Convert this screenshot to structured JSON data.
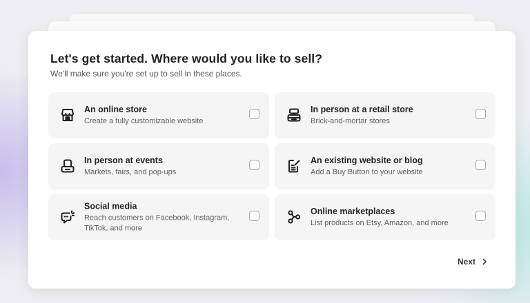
{
  "page": {
    "title": "Let's get started. Where would you like to sell?",
    "subtitle": "We'll make sure you're set up to sell in these places."
  },
  "options": [
    {
      "title": "An online store",
      "description": "Create a fully customizable website",
      "icon": "storefront-icon",
      "checked": false
    },
    {
      "title": "In person at a retail store",
      "description": "Brick-and-mortar stores",
      "icon": "pos-terminal-icon",
      "checked": false
    },
    {
      "title": "In person at events",
      "description": "Markets, fairs, and pop-ups",
      "icon": "card-reader-icon",
      "checked": false
    },
    {
      "title": "An existing website or blog",
      "description": "Add a Buy Button to your website",
      "icon": "edit-document-icon",
      "checked": false
    },
    {
      "title": "Social media",
      "description": "Reach customers on Facebook, Instagram, TikTok, and more",
      "icon": "chat-bubble-icon",
      "checked": false
    },
    {
      "title": "Online marketplaces",
      "description": "List products on Etsy, Amazon, and more",
      "icon": "nodes-icon",
      "checked": false
    }
  ],
  "footer": {
    "next_label": "Next",
    "next_icon": "chevron-right-icon"
  },
  "colors": {
    "card_background": "#ffffff",
    "option_background": "#f5f5f6",
    "text_primary": "#232327",
    "text_secondary": "#616166"
  }
}
